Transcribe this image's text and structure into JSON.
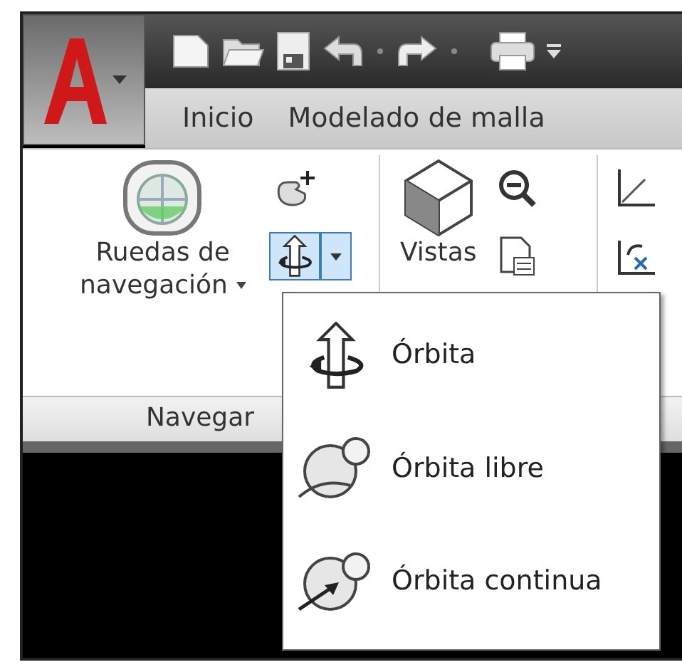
{
  "tabs": [
    {
      "label": "Inicio"
    },
    {
      "label": "Modelado de malla"
    }
  ],
  "ribbon": {
    "panel_title": "Navegar",
    "wheel_button": {
      "label_lines": [
        "Ruedas de",
        "navegación"
      ]
    },
    "orbit_split_button": {
      "highlighted": true
    },
    "views_button": {
      "label": "Vistas"
    }
  },
  "orbit_menu": {
    "items": [
      {
        "kind": "orbit",
        "label": "Órbita"
      },
      {
        "kind": "free-orbit",
        "label": "Órbita libre"
      },
      {
        "kind": "continuous-orbit",
        "label": "Órbita continua"
      }
    ]
  }
}
